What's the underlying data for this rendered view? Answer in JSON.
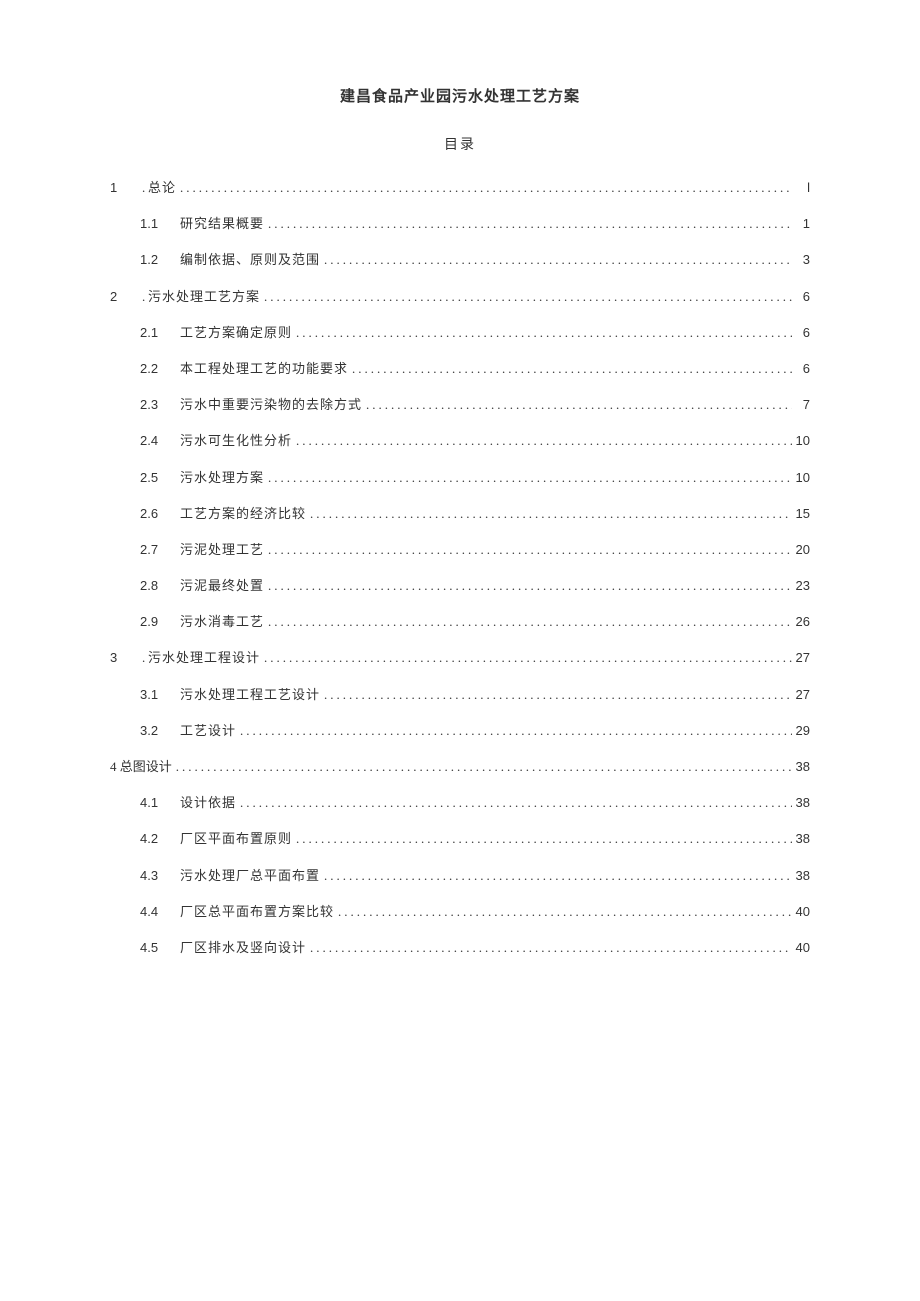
{
  "title": "建昌食品产业园污水处理工艺方案",
  "toc_label": "目录",
  "toc": [
    {
      "level": 1,
      "num": "1",
      "sep": ".",
      "text": "总论",
      "page": "l"
    },
    {
      "level": 2,
      "num": "1.1",
      "text": "研究结果概要",
      "page": "1"
    },
    {
      "level": 2,
      "num": "1.2",
      "text": "编制依据、原则及范围",
      "page": "3"
    },
    {
      "level": 1,
      "num": "2",
      "sep": ".",
      "text": "污水处理工艺方案",
      "page": "6"
    },
    {
      "level": 2,
      "num": "2.1",
      "text": "工艺方案确定原则",
      "page": "6"
    },
    {
      "level": 2,
      "num": "2.2",
      "text": "本工程处理工艺的功能要求",
      "page": "6"
    },
    {
      "level": 2,
      "num": "2.3",
      "text": "污水中重要污染物的去除方式",
      "page": "7"
    },
    {
      "level": 2,
      "num": "2.4",
      "text": "污水可生化性分析",
      "page": "10"
    },
    {
      "level": 2,
      "num": "2.5",
      "text": "污水处理方案",
      "page": "10"
    },
    {
      "level": 2,
      "num": "2.6",
      "text": "工艺方案的经济比较",
      "page": "15"
    },
    {
      "level": 2,
      "num": "2.7",
      "text": "污泥处理工艺",
      "page": "20"
    },
    {
      "level": 2,
      "num": "2.8",
      "text": "污泥最终处置",
      "page": "23"
    },
    {
      "level": 2,
      "num": "2.9",
      "text": "污水消毒工艺",
      "page": "26"
    },
    {
      "level": 1,
      "num": "3",
      "sep": ".",
      "text": "污水处理工程设计",
      "page": "27"
    },
    {
      "level": 2,
      "num": "3.1",
      "text": "污水处理工程工艺设计",
      "page": "27"
    },
    {
      "level": 2,
      "num": "3.2",
      "text": "工艺设计",
      "page": "29"
    },
    {
      "level": 0,
      "combined": "4 总图设计",
      "page": "38"
    },
    {
      "level": 2,
      "num": "4.1",
      "text": "设计依据",
      "page": "38"
    },
    {
      "level": 2,
      "num": "4.2",
      "text": "厂区平面布置原则",
      "page": "38"
    },
    {
      "level": 2,
      "num": "4.3",
      "text": "污水处理厂总平面布置",
      "page": "38"
    },
    {
      "level": 2,
      "num": "4.4",
      "text": "厂区总平面布置方案比较",
      "page": "40"
    },
    {
      "level": 2,
      "num": "4.5",
      "text": "厂区排水及竖向设计",
      "page": "40"
    }
  ]
}
